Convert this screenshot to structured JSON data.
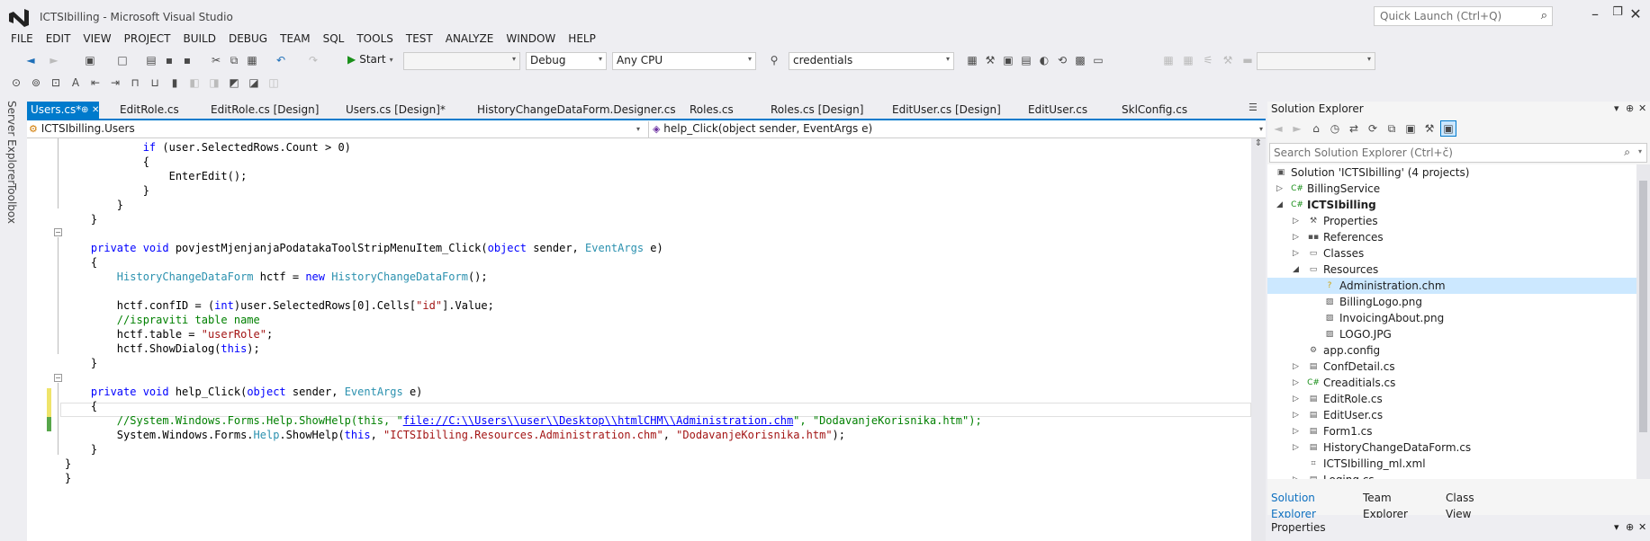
{
  "window": {
    "title": "ICTSIbilling - Microsoft Visual Studio",
    "quick_launch_placeholder": "Quick Launch (Ctrl+Q)"
  },
  "menu": [
    "FILE",
    "EDIT",
    "VIEW",
    "PROJECT",
    "BUILD",
    "DEBUG",
    "TEAM",
    "SQL",
    "TOOLS",
    "TEST",
    "ANALYZE",
    "WINDOW",
    "HELP"
  ],
  "toolbar": {
    "start_label": "Start",
    "configuration": "Debug",
    "platform": "Any CPU",
    "find_value": "credentials"
  },
  "left_tabs": [
    "Server Explorer",
    "Toolbox"
  ],
  "doc_tabs": [
    {
      "label": "Users.cs*",
      "active": true
    },
    {
      "label": "EditRole.cs"
    },
    {
      "label": "EditRole.cs [Design]"
    },
    {
      "label": "Users.cs [Design]*"
    },
    {
      "label": "HistoryChangeDataForm.Designer.cs"
    },
    {
      "label": "Roles.cs"
    },
    {
      "label": "Roles.cs [Design]"
    },
    {
      "label": "EditUser.cs [Design]"
    },
    {
      "label": "EditUser.cs"
    },
    {
      "label": "SklConfig.cs"
    }
  ],
  "navbar": {
    "class_selector": "ICTSIbilling.Users",
    "member_selector": "help_Click(object sender, EventArgs e)"
  },
  "code_lines": [
    "            if (user.SelectedRows.Count > 0)",
    "            {",
    "                EnterEdit();",
    "            }",
    "        }",
    "    }",
    "",
    "    private void povjestMjenjanjaPodatakaToolStripMenuItem_Click(object sender, EventArgs e)",
    "    {",
    "        HistoryChangeDataForm hctf = new HistoryChangeDataForm();",
    "",
    "        hctf.confID = (int)user.SelectedRows[0].Cells[\"id\"].Value;",
    "        //ispraviti table name",
    "        hctf.table = \"userRole\";",
    "        hctf.ShowDialog(this);",
    "    }",
    "",
    "    private void help_Click(object sender, EventArgs e)",
    "    {",
    "        //System.Windows.Forms.Help.ShowHelp(this, \"file://C:\\\\Users\\\\user\\\\Desktop\\\\htmlCHM\\\\Administration.chm\", \"DodavanjeKorisnika.htm\");",
    "        System.Windows.Forms.Help.ShowHelp(this, \"ICTSIbilling.Resources.Administration.chm\", \"DodavanjeKorisnika.htm\");",
    "    }",
    "}",
    "}"
  ],
  "solution_explorer": {
    "title": "Solution Explorer",
    "search_placeholder": "Search Solution Explorer (Ctrl+č)",
    "tree": [
      {
        "label": "Solution 'ICTSIbilling' (4 projects)",
        "icon": "solution-icon",
        "bold": false
      },
      {
        "label": "BillingService",
        "icon": "csharp-project-icon",
        "bold": false
      },
      {
        "label": "ICTSIbilling",
        "icon": "csharp-project-icon",
        "bold": true
      },
      {
        "label": "Properties",
        "icon": "wrench-icon"
      },
      {
        "label": "References",
        "icon": "references-icon"
      },
      {
        "label": "Classes",
        "icon": "folder-icon"
      },
      {
        "label": "Resources",
        "icon": "folder-open-icon"
      },
      {
        "label": "Administration.chm",
        "icon": "help-file-icon",
        "selected": true
      },
      {
        "label": "BillingLogo.png",
        "icon": "image-icon"
      },
      {
        "label": "InvoicingAbout.png",
        "icon": "image-icon"
      },
      {
        "label": "LOGO.JPG",
        "icon": "image-icon"
      },
      {
        "label": "app.config",
        "icon": "config-icon"
      },
      {
        "label": "ConfDetail.cs",
        "icon": "form-icon"
      },
      {
        "label": "Creaditials.cs",
        "icon": "csharp-file-icon"
      },
      {
        "label": "EditRole.cs",
        "icon": "form-icon"
      },
      {
        "label": "EditUser.cs",
        "icon": "form-icon"
      },
      {
        "label": "Form1.cs",
        "icon": "form-icon"
      },
      {
        "label": "HistoryChangeDataForm.cs",
        "icon": "form-icon"
      },
      {
        "label": "ICTSIbilling_ml.xml",
        "icon": "xml-icon"
      },
      {
        "label": "Loging.cs",
        "icon": "form-icon"
      }
    ],
    "tabs": [
      "Solution Explorer",
      "Team Explorer",
      "Class View"
    ]
  },
  "properties_title": "Properties",
  "colors": {
    "accent": "#007acc",
    "keyword": "#0000ff",
    "type": "#2b91af",
    "string": "#a31515",
    "comment": "#008000"
  }
}
